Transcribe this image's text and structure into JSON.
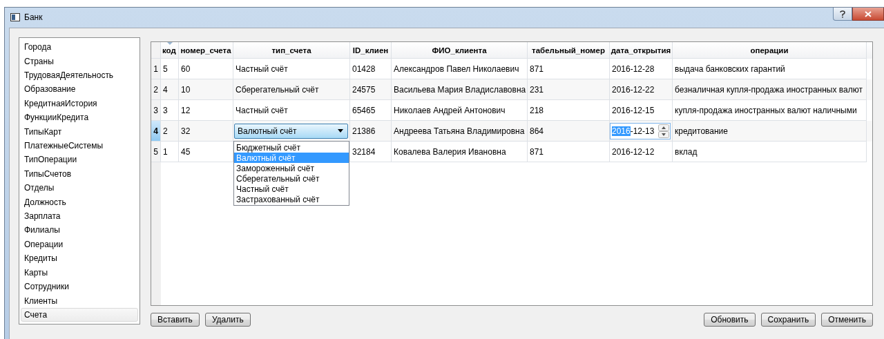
{
  "window": {
    "title": "Банк"
  },
  "sidebar": {
    "items": [
      {
        "label": "Города",
        "selected": false
      },
      {
        "label": "Страны",
        "selected": false
      },
      {
        "label": "ТрудоваяДеятельность",
        "selected": false
      },
      {
        "label": "Образование",
        "selected": false
      },
      {
        "label": "КредитнаяИстория",
        "selected": false
      },
      {
        "label": "ФункцииКредита",
        "selected": false
      },
      {
        "label": "ТипыКарт",
        "selected": false
      },
      {
        "label": "ПлатежныеСистемы",
        "selected": false
      },
      {
        "label": "ТипОперации",
        "selected": false
      },
      {
        "label": "ТипыСчетов",
        "selected": false
      },
      {
        "label": "Отделы",
        "selected": false
      },
      {
        "label": "Должность",
        "selected": false
      },
      {
        "label": "Зарплата",
        "selected": false
      },
      {
        "label": "Филиалы",
        "selected": false
      },
      {
        "label": "Операции",
        "selected": false
      },
      {
        "label": "Кредиты",
        "selected": false
      },
      {
        "label": "Карты",
        "selected": false
      },
      {
        "label": "Сотрудники",
        "selected": false
      },
      {
        "label": "Клиенты",
        "selected": false
      },
      {
        "label": "Счета",
        "selected": true
      }
    ]
  },
  "table": {
    "columns": [
      {
        "label": "код",
        "sorted": true
      },
      {
        "label": "номер_счета",
        "sorted": false
      },
      {
        "label": "тип_счета",
        "sorted": false
      },
      {
        "label": "ID_клиен",
        "sorted": false
      },
      {
        "label": "ФИО_клиента",
        "sorted": false
      },
      {
        "label": "табельный_номер",
        "sorted": false
      },
      {
        "label": "дата_открытия",
        "sorted": false
      },
      {
        "label": "операции",
        "sorted": false
      }
    ],
    "rows": [
      {
        "header": "1",
        "selected": false,
        "cells": [
          {
            "kind": "text",
            "text": "5"
          },
          {
            "kind": "text",
            "text": "60"
          },
          {
            "kind": "text",
            "text": "Частный счёт"
          },
          {
            "kind": "text",
            "text": "01428"
          },
          {
            "kind": "text",
            "text": "Александров Павел Николаевич"
          },
          {
            "kind": "text",
            "text": "871"
          },
          {
            "kind": "text",
            "text": "2016-12-28"
          },
          {
            "kind": "text",
            "text": "выдача банковских гарантий"
          }
        ]
      },
      {
        "header": "2",
        "selected": false,
        "cells": [
          {
            "kind": "text",
            "text": "4"
          },
          {
            "kind": "text",
            "text": "10"
          },
          {
            "kind": "text",
            "text": "Сберегательный счёт"
          },
          {
            "kind": "text",
            "text": "24575"
          },
          {
            "kind": "text",
            "text": "Васильева Мария Владиславовна"
          },
          {
            "kind": "text",
            "text": "231"
          },
          {
            "kind": "text",
            "text": "2016-12-22"
          },
          {
            "kind": "text",
            "text": "безналичная купля-продажа иностранных валют"
          }
        ]
      },
      {
        "header": "3",
        "selected": false,
        "cells": [
          {
            "kind": "text",
            "text": "3"
          },
          {
            "kind": "text",
            "text": "12"
          },
          {
            "kind": "text",
            "text": "Частный счёт"
          },
          {
            "kind": "text",
            "text": "65465"
          },
          {
            "kind": "text",
            "text": "Николаев Андрей Антонович"
          },
          {
            "kind": "text",
            "text": "218"
          },
          {
            "kind": "text",
            "text": "2016-12-15"
          },
          {
            "kind": "text",
            "text": "купля-продажа иностранных валют наличными"
          }
        ]
      },
      {
        "header": "4",
        "selected": true,
        "cells": [
          {
            "kind": "text",
            "text": "2"
          },
          {
            "kind": "text",
            "text": "32"
          },
          {
            "kind": "combo",
            "value": "Валютный счёт",
            "options": [
              {
                "label": "Бюджетный счёт",
                "selected": false
              },
              {
                "label": "Валютный счёт",
                "selected": true
              },
              {
                "label": "Замороженный счёт",
                "selected": false
              },
              {
                "label": "Сберегательный счёт",
                "selected": false
              },
              {
                "label": "Частный счёт",
                "selected": false
              },
              {
                "label": "Застрахованный счёт",
                "selected": false
              }
            ]
          },
          {
            "kind": "text",
            "text": "21386"
          },
          {
            "kind": "text",
            "text": "Андреева Татьяна Владимировна"
          },
          {
            "kind": "text",
            "text": "864"
          },
          {
            "kind": "date",
            "selected_text": "2016",
            "text": "-12-13"
          },
          {
            "kind": "text",
            "text": "кредитование"
          }
        ]
      },
      {
        "header": "5",
        "selected": false,
        "cells": [
          {
            "kind": "text",
            "text": "1"
          },
          {
            "kind": "text",
            "text": "45"
          },
          {
            "kind": "covered"
          },
          {
            "kind": "text",
            "text": "32184"
          },
          {
            "kind": "text",
            "text": "Ковалева Валерия Ивановна"
          },
          {
            "kind": "text",
            "text": "871"
          },
          {
            "kind": "text",
            "text": "2016-12-12"
          },
          {
            "kind": "text",
            "text": "вклад"
          }
        ]
      }
    ]
  },
  "left_buttons": [
    "Вставить",
    "Удалить"
  ],
  "right_buttons": [
    "Обновить",
    "Сохранить",
    "Отменить"
  ]
}
